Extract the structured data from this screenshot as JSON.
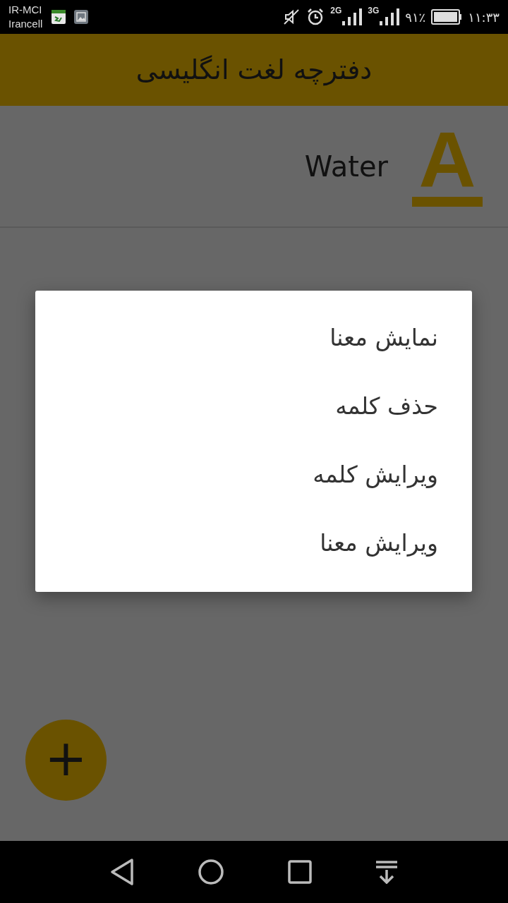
{
  "status_bar": {
    "carriers": [
      "IR-MCI",
      "Irancell"
    ],
    "sim_1": {
      "network": "2G"
    },
    "sim_2": {
      "network": "3G"
    },
    "battery": "۹۱٪",
    "time": "۱۱:۳۳"
  },
  "app_bar": {
    "title": "دفترچه لغت انگلیسی"
  },
  "words": [
    {
      "word": "Water",
      "icon_letter": "A"
    }
  ],
  "dialog": {
    "items": [
      "نمایش معنا",
      "حذف کلمه",
      "ویرایش کلمه",
      "ویرایش معنا"
    ]
  },
  "fab": {
    "label": "+"
  }
}
